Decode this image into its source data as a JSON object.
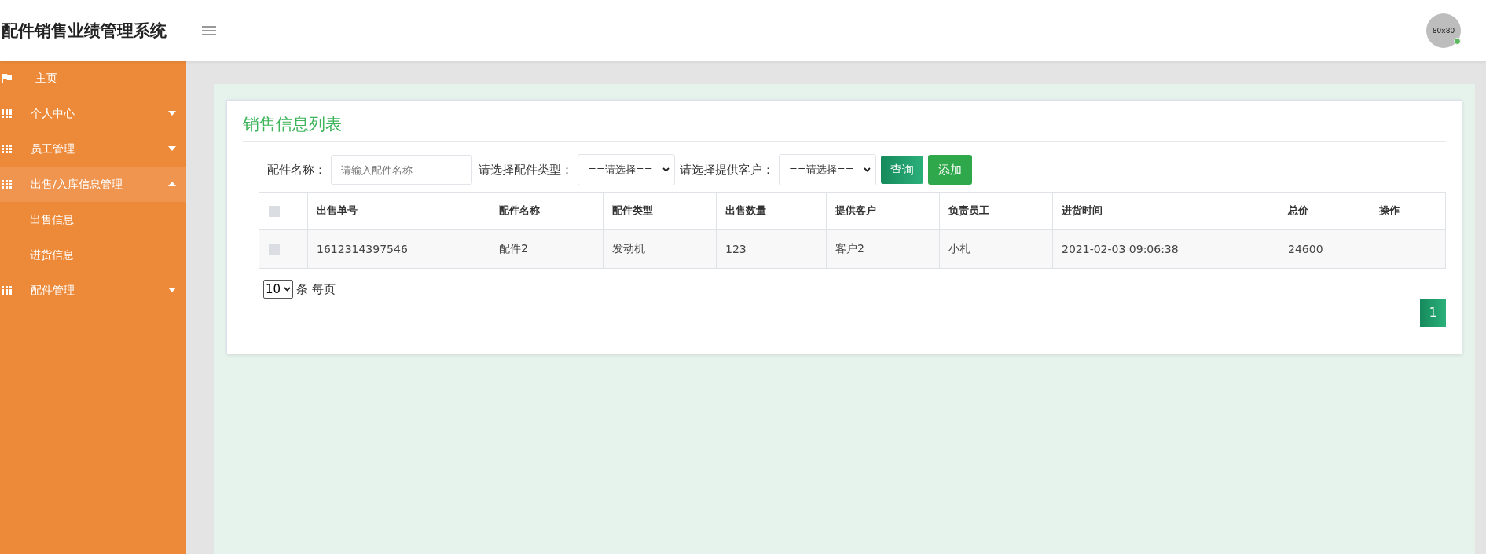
{
  "header": {
    "title": "配件销售业绩管理系统",
    "avatar_text": "80x80"
  },
  "sidebar": {
    "items": [
      {
        "kind": "flag",
        "label": "主页",
        "selected": false
      },
      {
        "kind": "grid",
        "label": "个人中心",
        "expanded": false,
        "selected": false
      },
      {
        "kind": "grid",
        "label": "员工管理",
        "expanded": false,
        "selected": false
      },
      {
        "kind": "grid",
        "label": "出售/入库信息管理",
        "expanded": true,
        "selected": true,
        "children": [
          {
            "label": "出售信息"
          },
          {
            "label": "进货信息"
          }
        ]
      },
      {
        "kind": "grid",
        "label": "配件管理",
        "expanded": false,
        "selected": false
      }
    ]
  },
  "panel": {
    "title": "销售信息列表",
    "filters": [
      {
        "kind": "input",
        "label": "配件名称：",
        "placeholder": "请输入配件名称"
      },
      {
        "kind": "select",
        "label": "请选择配件类型：",
        "value": "==请选择=="
      },
      {
        "kind": "select",
        "label": "请选择提供客户：",
        "value": "==请选择=="
      }
    ],
    "buttons": [
      {
        "kind": "search",
        "label": "查询"
      },
      {
        "kind": "add",
        "label": "添加"
      }
    ],
    "table": {
      "header_checked": false,
      "columns": [
        "出售单号",
        "配件名称",
        "配件类型",
        "出售数量",
        "提供客户",
        "负责员工",
        "进货时间",
        "总价",
        "操作"
      ],
      "rows": [
        {
          "checked": false,
          "cells": [
            "1612314397546",
            "配件2",
            "发动机",
            "123",
            "客户2",
            "小札",
            "2021-02-03 09:06:38",
            "24600",
            ""
          ]
        }
      ]
    },
    "page_size": {
      "value": "10",
      "label": "条 每页"
    },
    "pages": [
      {
        "label": "1",
        "selected": true
      }
    ]
  }
}
